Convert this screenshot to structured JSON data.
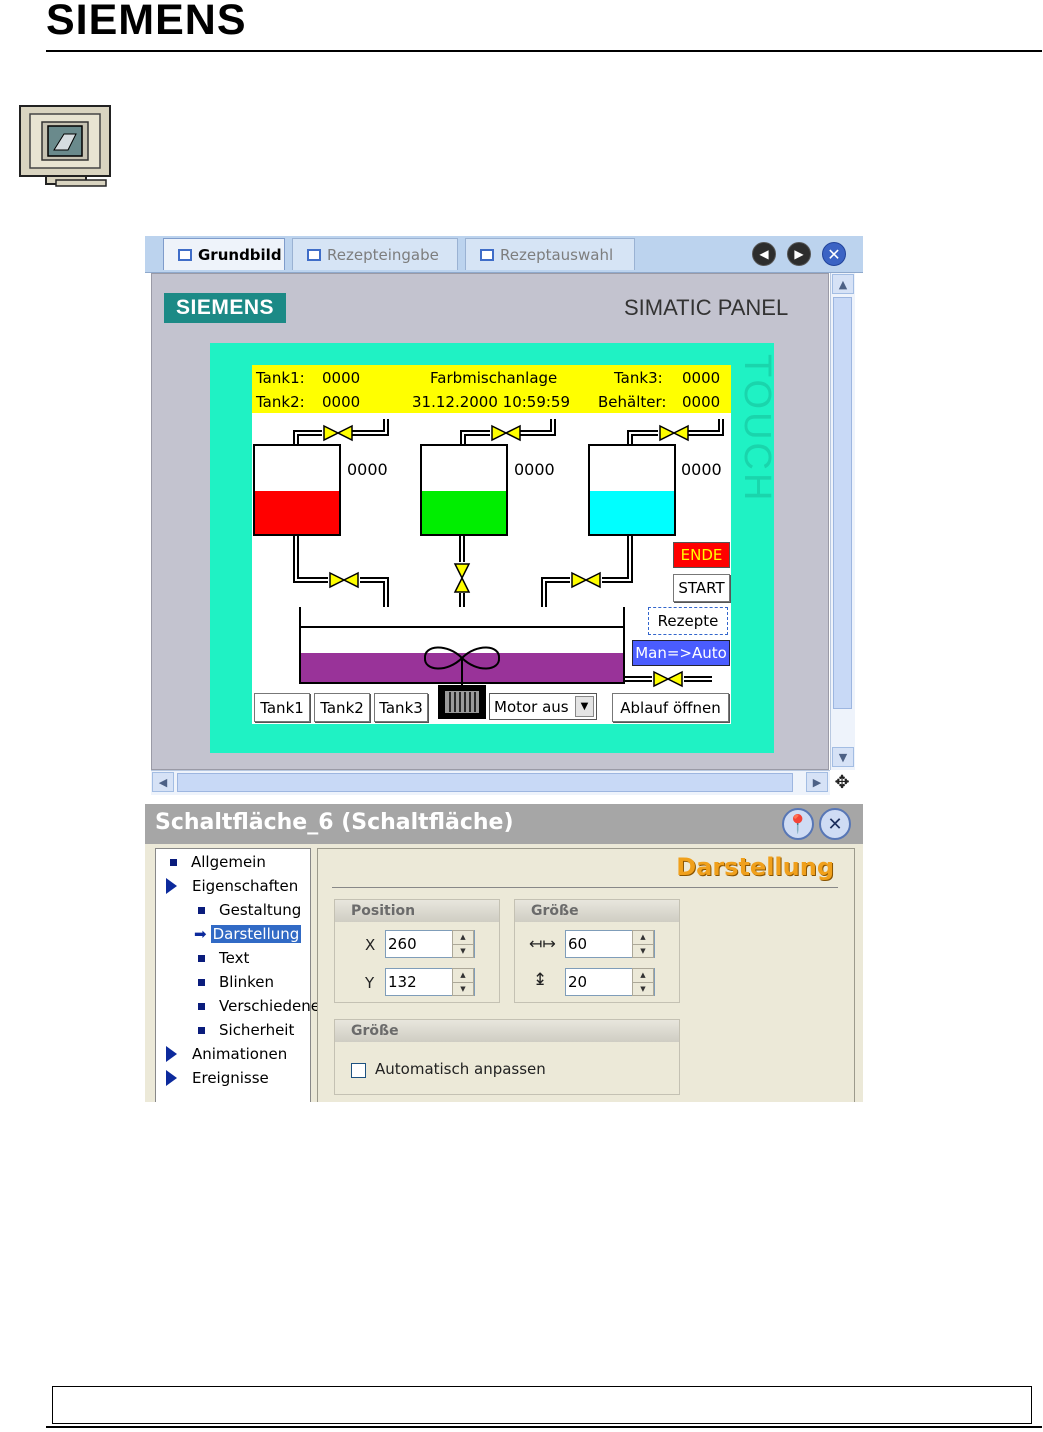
{
  "brand": "SIEMENS",
  "tabs": [
    {
      "label": "Grundbild",
      "active": true
    },
    {
      "label": "Rezepteingabe",
      "active": false
    },
    {
      "label": "Rezeptauswahl",
      "active": false
    }
  ],
  "panel": {
    "logo": "SIEMENS",
    "title": "SIMATIC PANEL",
    "touch": "TOUCH"
  },
  "hmi": {
    "tank1_label": "Tank1:",
    "tank1_value": "0000",
    "tank2_label": "Tank2:",
    "tank2_value": "0000",
    "plant_title": "Farbmischanlage",
    "datetime": "31.12.2000 10:59:59",
    "tank3_label": "Tank3:",
    "tank3_value": "0000",
    "container_label": "Behälter:",
    "container_value": "0000",
    "tank_levels": [
      {
        "value": "0000",
        "color": "#ff0000"
      },
      {
        "value": "0000",
        "color": "#00ee00"
      },
      {
        "value": "0000",
        "color": "#00ffff"
      }
    ],
    "mixer_color": "#993399",
    "buttons": {
      "ende": "ENDE",
      "start": "START",
      "rezepte": "Rezepte",
      "man_auto": "Man=>Auto",
      "tank1": "Tank1",
      "tank2": "Tank2",
      "tank3": "Tank3",
      "motor": "Motor aus",
      "ablauf": "Ablauf öffnen"
    },
    "colors": {
      "ende": "#ff0000",
      "man_auto": "#4a5cff",
      "valve": "#ffff00"
    }
  },
  "props": {
    "title": "Schaltfläche_6 (Schaltfläche)",
    "tree": [
      {
        "label": "Allgemein",
        "kind": "leaf0"
      },
      {
        "label": "Eigenschaften",
        "kind": "node0"
      },
      {
        "label": "Gestaltung",
        "kind": "leaf1"
      },
      {
        "label": "Darstellung",
        "kind": "selected"
      },
      {
        "label": "Text",
        "kind": "leaf1"
      },
      {
        "label": "Blinken",
        "kind": "leaf1"
      },
      {
        "label": "Verschiedene",
        "kind": "leaf1"
      },
      {
        "label": "Sicherheit",
        "kind": "leaf1"
      },
      {
        "label": "Animationen",
        "kind": "node0"
      },
      {
        "label": "Ereignisse",
        "kind": "node0"
      }
    ],
    "section": "Darstellung",
    "position_group": "Position",
    "x_label": "X",
    "x_value": "260",
    "y_label": "Y",
    "y_value": "132",
    "size_group": "Größe",
    "width_value": "60",
    "height_value": "20",
    "size_group2": "Größe",
    "auto_fit": "Automatisch anpassen"
  }
}
